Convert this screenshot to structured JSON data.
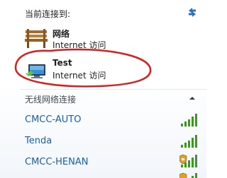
{
  "connected": {
    "header": "当前连接到:",
    "networks": [
      {
        "name": "网络",
        "status": "Internet 访问",
        "icon": "bench-icon"
      },
      {
        "name": "Test",
        "status": "Internet 访问",
        "icon": "network-computer-icon"
      }
    ]
  },
  "wireless": {
    "header": "无线网络连接",
    "networks": [
      {
        "ssid": "CMCC-AUTO",
        "signal": 5,
        "secured": false
      },
      {
        "ssid": "Tenda",
        "signal": 5,
        "secured": false
      },
      {
        "ssid": "CMCC-HENAN",
        "signal": 5,
        "secured": true
      },
      {
        "ssid": "",
        "signal": 5,
        "secured": true
      }
    ]
  },
  "colors": {
    "link": "#1a5fa8",
    "signal_green": "#3a9a1a",
    "annotation_red": "#d81e1e"
  }
}
